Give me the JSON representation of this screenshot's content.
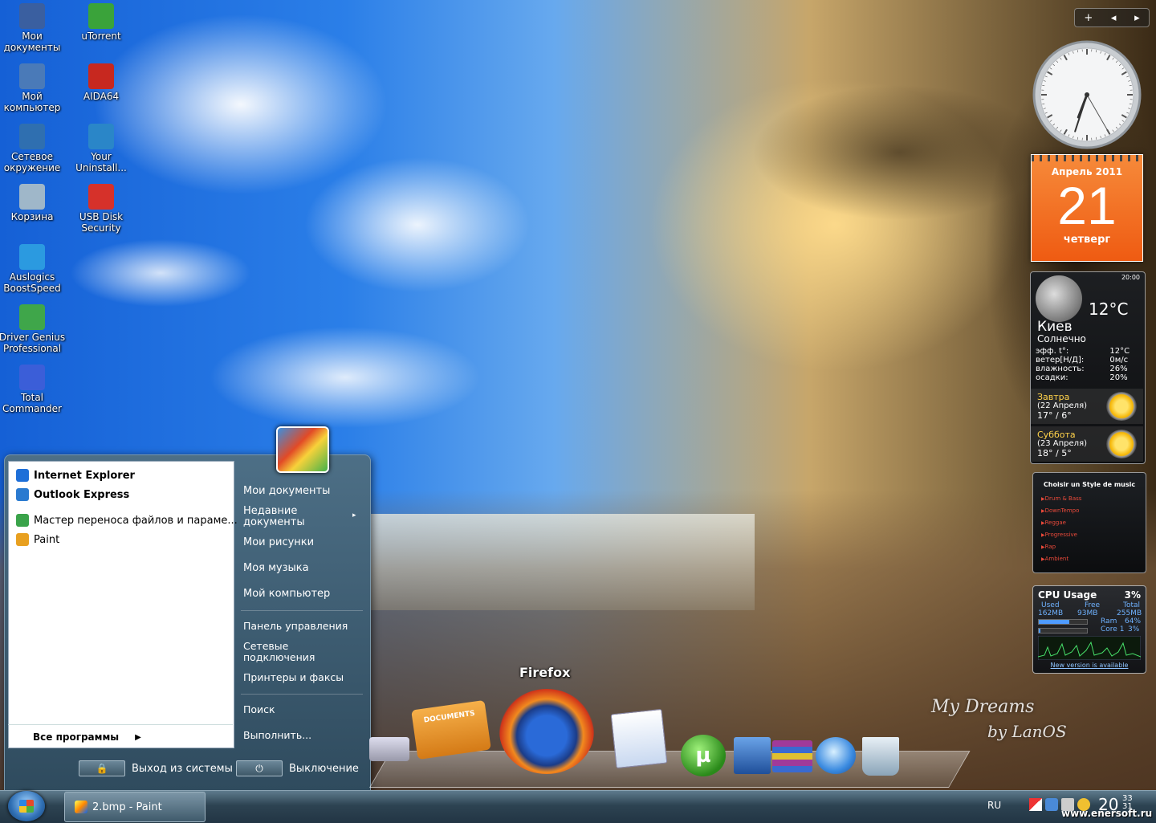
{
  "desktop": {
    "icons_col1": [
      {
        "label": "Мои документы",
        "icon": "my-documents-icon",
        "color": "#3a5fa0"
      },
      {
        "label": "Мой компьютер",
        "icon": "my-computer-icon",
        "color": "#4a7ab8"
      },
      {
        "label": "Сетевое окружение",
        "icon": "network-icon",
        "color": "#2f6fb0"
      },
      {
        "label": "Корзина",
        "icon": "recycle-bin-icon",
        "color": "#9fb7c9"
      },
      {
        "label": "Auslogics BoostSpeed",
        "icon": "boostspeed-icon",
        "color": "#2b9ae0"
      },
      {
        "label": "Driver Genius Professional",
        "icon": "driver-genius-icon",
        "color": "#3fa64a"
      },
      {
        "label": "Total Commander",
        "icon": "total-commander-icon",
        "color": "#3b5ed8"
      }
    ],
    "icons_col2": [
      {
        "label": "uTorrent",
        "icon": "utorrent-icon",
        "color": "#3aa33a"
      },
      {
        "label": "AIDA64",
        "icon": "aida64-icon",
        "color": "#c7281f"
      },
      {
        "label": "Your Uninstall...",
        "icon": "your-uninstaller-icon",
        "color": "#2a86c8"
      },
      {
        "label": "USB Disk Security",
        "icon": "usb-disk-security-icon",
        "color": "#d6312a"
      }
    ],
    "signature_line1": "My Dreams",
    "signature_line2": "by LanOS"
  },
  "gadgets": {
    "toolbar": {
      "add": "+",
      "prev": "◂",
      "next": "▸"
    },
    "clock": {
      "hour": 6.7,
      "minute": 33,
      "second": 25
    },
    "calendar": {
      "month": "Апрель 2011",
      "day": "21",
      "weekday": "четверг"
    },
    "weather": {
      "time": "20:00",
      "temp": "12°C",
      "city": "Киев",
      "condition": "Солнечно",
      "rows": [
        {
          "label": "эфф. t°:",
          "value": "12°C"
        },
        {
          "label": "ветер[Н/Д]:",
          "value": "0м/с"
        },
        {
          "label": "влажность:",
          "value": "26%"
        },
        {
          "label": "осадки:",
          "value": "20%"
        }
      ],
      "forecast": [
        {
          "name": "Завтра",
          "date": "(22 Апреля)",
          "temps": "17° / 6°"
        },
        {
          "name": "Суббота",
          "date": "(23 Апреля)",
          "temps": "18° / 5°"
        }
      ]
    },
    "music": {
      "title": "Choisir un Style de music",
      "styles": [
        "Drum & Bass",
        "DownTempo",
        "Reggae",
        "Progressive",
        "Rap",
        "Ambient"
      ]
    },
    "cpu": {
      "title": "CPU Usage",
      "percent": "3%",
      "used_label": "Used",
      "free_label": "Free",
      "total_label": "Total",
      "used": "162MB",
      "free": "93MB",
      "total": "255MB",
      "ram_label": "Ram",
      "ram": "64%",
      "ram_fraction": 0.64,
      "core_label": "Core 1",
      "core": "3%",
      "core_fraction": 0.03,
      "update_link": "New version is available"
    }
  },
  "start_menu": {
    "pinned": [
      {
        "label": "Internet Explorer",
        "icon": "internet-explorer-icon",
        "color": "#1e6fd8"
      },
      {
        "label": "Outlook Express",
        "icon": "outlook-express-icon",
        "color": "#2a7ad0"
      }
    ],
    "recent": [
      {
        "label": "Мастер переноса файлов и параме...",
        "icon": "transfer-wizard-icon",
        "color": "#3aa34a"
      },
      {
        "label": "Paint",
        "icon": "paint-icon",
        "color": "#e8a020"
      }
    ],
    "all_programs": "Все программы",
    "right": {
      "my_documents": "Мои документы",
      "recent_documents": "Недавние документы",
      "my_pictures": "Мои рисунки",
      "my_music": "Моя музыка",
      "my_computer": "Мой компьютер",
      "control_panel": "Панель управления",
      "network_connections": "Сетевые подключения",
      "printers": "Принтеры и факсы",
      "search": "Поиск",
      "run": "Выполнить..."
    },
    "logoff": "Выход из системы",
    "shutdown": "Выключение"
  },
  "dock": {
    "firefox_label": "Firefox",
    "documents_label": "DOCUMENTS"
  },
  "taskbar": {
    "task": "2.bmp - Paint",
    "language": "RU",
    "time_hour": "20",
    "time_min": "33",
    "time_sec": "31"
  },
  "watermark": "www.enersoft.ru"
}
